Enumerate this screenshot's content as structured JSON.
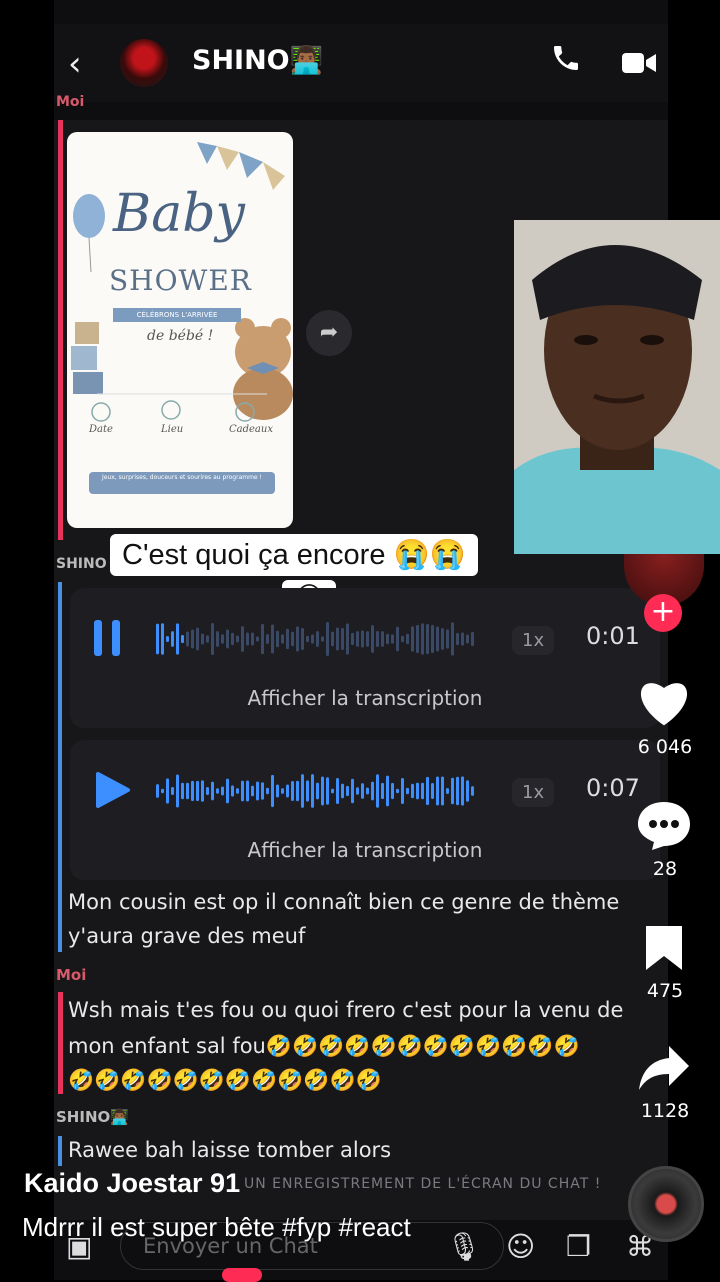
{
  "chat_header": {
    "name": "SHINO👨🏾‍💻",
    "back_icon": "chevron-left-icon",
    "call_icon": "phone-icon",
    "video_icon": "video-icon"
  },
  "messages": {
    "moi_label_top": "Moi",
    "shino_label": "SHINO",
    "voice1": {
      "speed": "1x",
      "time": "0:01",
      "transcript": "Afficher la transcription",
      "state": "playing"
    },
    "voice2": {
      "speed": "1x",
      "time": "0:07",
      "transcript": "Afficher la transcription",
      "state": "paused"
    },
    "shino_text_1": "Mon cousin est op il connaît bien ce genre de thème",
    "shino_text_2": "y'aura grave des meuf",
    "moi_label": "Moi",
    "moi_text_1": "Wsh mais t'es fou ou quoi frero c'est pour la venu de",
    "moi_text_2": "mon enfant sal fou🤣🤣🤣🤣🤣🤣🤣🤣🤣🤣🤣🤣",
    "moi_text_3": "🤣🤣🤣🤣🤣🤣🤣🤣🤣🤣🤣🤣",
    "shino_label_2": "SHINO👨🏾‍💻",
    "shino_text_3": "Rawee bah laisse tomber alors",
    "screen_record_notice": "UN ENREGISTREMENT DE L'ÉCRAN DU CHAT !",
    "chat_input_placeholder": "Envoyer un Chat"
  },
  "invite": {
    "title_1": "Baby",
    "title_2": "SHOWER",
    "ribbon": "CÉLÉBRONS L'ARRIVÉE",
    "subtitle": "de bébé !",
    "col1": "Date",
    "col2": "Lieu",
    "col3": "Cadeaux",
    "banner": "Jeux, surprises, douceurs et sourires au programme !"
  },
  "overlay": {
    "caption_line1": "C'est quoi ça encore 😭😭",
    "caption_line2": "😭"
  },
  "tiktok": {
    "likes": "6 046",
    "comments": "28",
    "saves": "475",
    "shares": "1128",
    "author": "Kaido Joestar 91",
    "description": "Mdrrr il est super bête #fyp #react",
    "follow_symbol": "+",
    "icons": {
      "like": "heart-icon",
      "comment": "comment-icon",
      "save": "bookmark-icon",
      "share": "share-icon"
    }
  }
}
